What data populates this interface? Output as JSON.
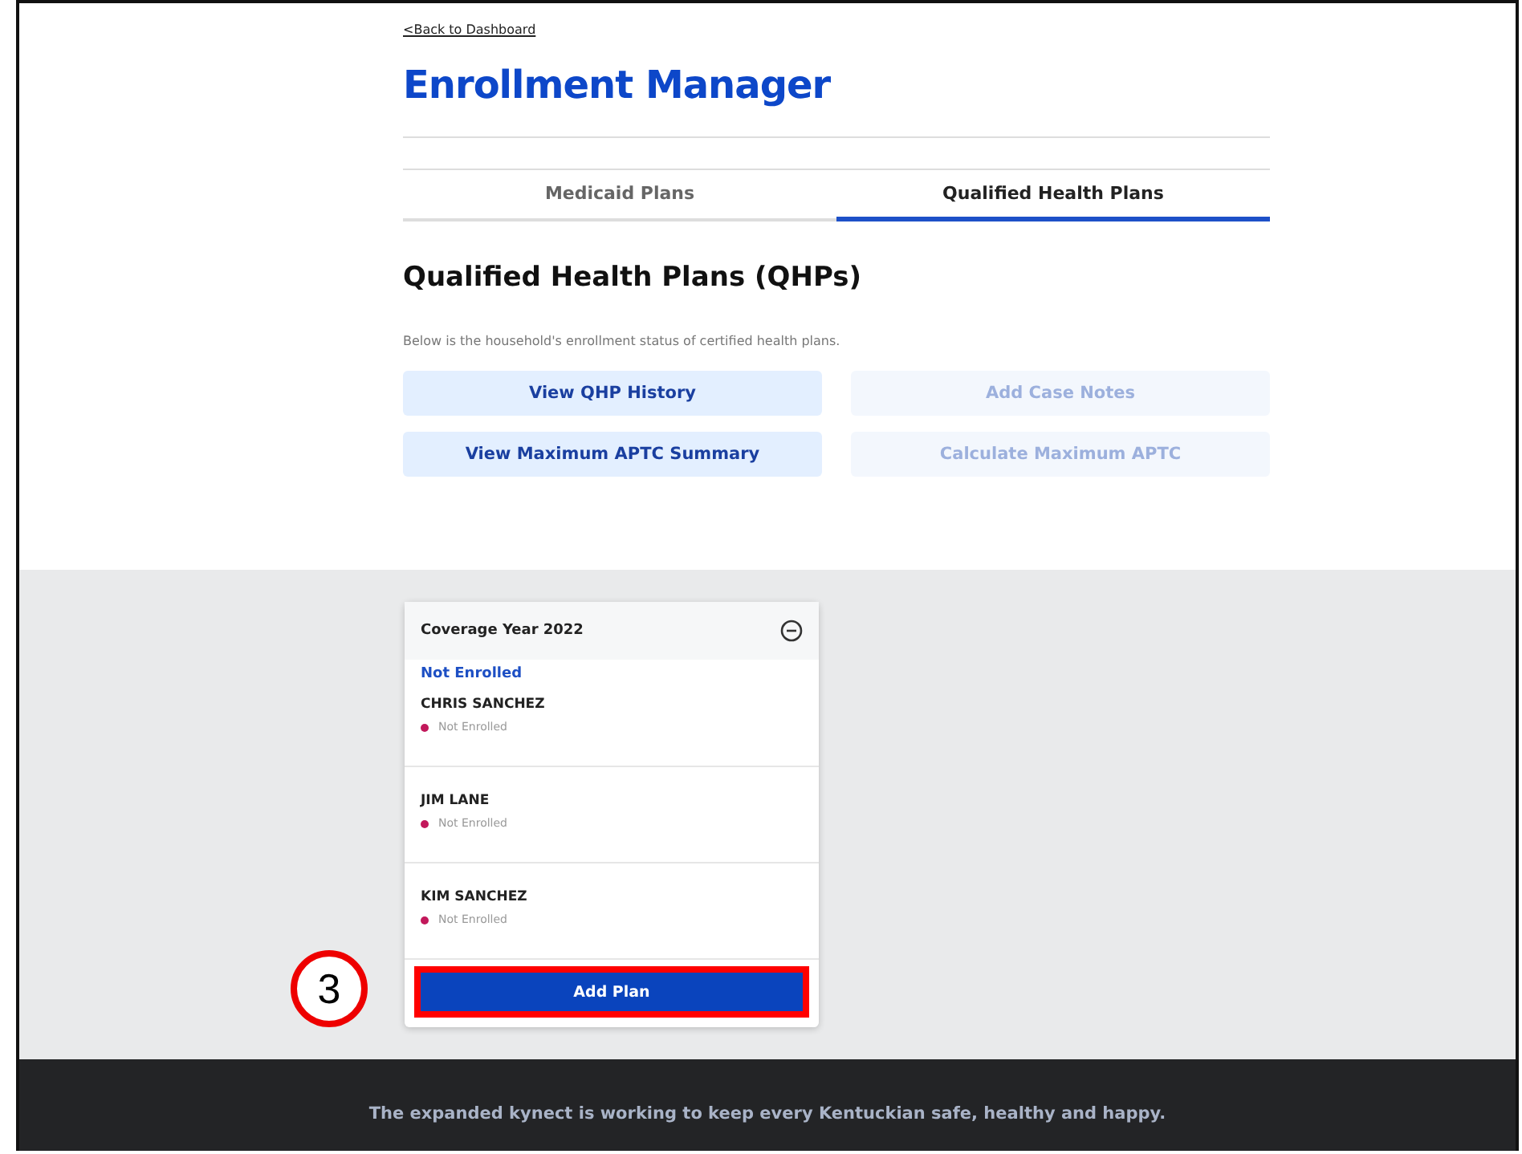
{
  "back_link": "<Back to Dashboard",
  "title": "Enrollment Manager",
  "tabs": [
    {
      "label": "Medicaid Plans",
      "selected": false
    },
    {
      "label": "Qualified Health Plans",
      "selected": true
    }
  ],
  "section": {
    "heading": "Qualified Health Plans (QHPs)",
    "description": "Below is the household's enrollment status of certified health plans."
  },
  "actions": [
    {
      "label": "View QHP History",
      "disabled": false
    },
    {
      "label": "Add Case Notes",
      "disabled": true
    },
    {
      "label": "View Maximum APTC Summary",
      "disabled": false
    },
    {
      "label": "Calculate Maximum APTC",
      "disabled": true
    }
  ],
  "coverage_card": {
    "title": "Coverage Year 2022",
    "expanded": true,
    "group_label": "Not Enrolled",
    "members": [
      {
        "name": "CHRIS SANCHEZ",
        "status": "Not Enrolled",
        "color": "#c2185b"
      },
      {
        "name": "JIM LANE",
        "status": "Not Enrolled",
        "color": "#c2185b"
      },
      {
        "name": "KIM SANCHEZ",
        "status": "Not Enrolled",
        "color": "#c2185b"
      }
    ],
    "button": {
      "label": "Add Plan",
      "highlighted": true
    },
    "callout": "3"
  },
  "footer": {
    "text": "The expanded kynect is working to keep every Kentuckian safe, healthy and happy."
  }
}
